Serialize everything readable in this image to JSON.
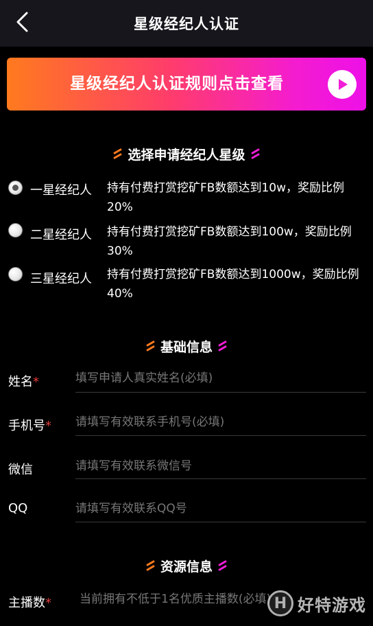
{
  "header": {
    "title": "星级经纪人认证"
  },
  "banner": {
    "text": "星级经纪人认证规则点击查看"
  },
  "levels_section": {
    "title": "选择申请经纪人星级"
  },
  "levels": [
    {
      "label": "一星经纪人",
      "desc": "持有付费打赏挖矿FB数额达到10w，奖励比例20%",
      "checked": true
    },
    {
      "label": "二星经纪人",
      "desc": "持有付费打赏挖矿FB数额达到100w，奖励比例30%",
      "checked": false
    },
    {
      "label": "三星经纪人",
      "desc": "持有付费打赏挖矿FB数额达到1000w，奖励比例40%",
      "checked": false
    }
  ],
  "basic_section": {
    "title": "基础信息"
  },
  "fields": {
    "name": {
      "label": "姓名",
      "required_mark": "*",
      "placeholder": "填写申请人真实姓名(必填)"
    },
    "phone": {
      "label": "手机号",
      "required_mark": "*",
      "placeholder": "请填写有效联系手机号(必填)"
    },
    "wechat": {
      "label": "微信",
      "placeholder": "请填写有效联系微信号"
    },
    "qq": {
      "label": "QQ",
      "placeholder": "请填写有效联系QQ号"
    }
  },
  "resource_section": {
    "title": "资源信息"
  },
  "resource_fields": {
    "anchors": {
      "label": "主播数",
      "required_mark": "*",
      "placeholder": "当前拥有不低于1名优质主播数(必填)"
    }
  },
  "watermark": {
    "logo": "H",
    "text": "好特游戏"
  },
  "colors": {
    "accent_orange": "#ff7a1e",
    "accent_pink": "#f21ed8",
    "required": "#e23b3b"
  }
}
